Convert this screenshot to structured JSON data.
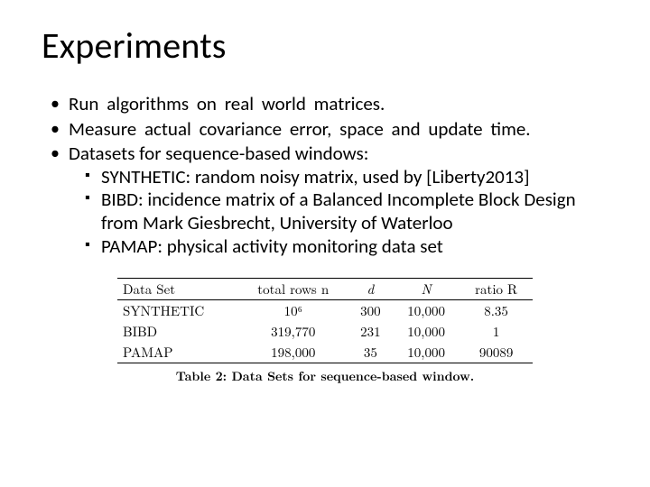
{
  "title": "Experiments",
  "bullets": {
    "b1": "Run  algorithms  on  real  world  matrices.",
    "b2": "Measure  actual  covariance  error,  space  and  update time.",
    "b3": "Datasets for sequence-based windows:",
    "sub1": "SYNTHETIC: random noisy matrix, used by [Liberty2013]",
    "sub2": "BIBD: incidence matrix of a Balanced Incomplete Block Design from Mark Giesbrecht, University of Waterloo",
    "sub3": "PAMAP: physical activity monitoring data set"
  },
  "table": {
    "headers": {
      "c0": "Data Set",
      "c1": "total rows n",
      "c2": "d",
      "c3": "N",
      "c4": "ratio R"
    },
    "rows": [
      {
        "c0": "SYNTHETIC",
        "c1": "10⁶",
        "c2": "300",
        "c3": "10,000",
        "c4": "8.35"
      },
      {
        "c0": "BIBD",
        "c1": "319,770",
        "c2": "231",
        "c3": "10,000",
        "c4": "1"
      },
      {
        "c0": "PAMAP",
        "c1": "198,000",
        "c2": "35",
        "c3": "10,000",
        "c4": "90089"
      }
    ],
    "caption": "Table 2:  Data Sets for sequence-based window."
  },
  "chart_data": {
    "type": "table",
    "title": "Data Sets for sequence-based window.",
    "columns": [
      "Data Set",
      "total rows n",
      "d",
      "N",
      "ratio R"
    ],
    "rows": [
      [
        "SYNTHETIC",
        1000000,
        300,
        10000,
        8.35
      ],
      [
        "BIBD",
        319770,
        231,
        10000,
        1
      ],
      [
        "PAMAP",
        198000,
        35,
        10000,
        90089
      ]
    ]
  }
}
